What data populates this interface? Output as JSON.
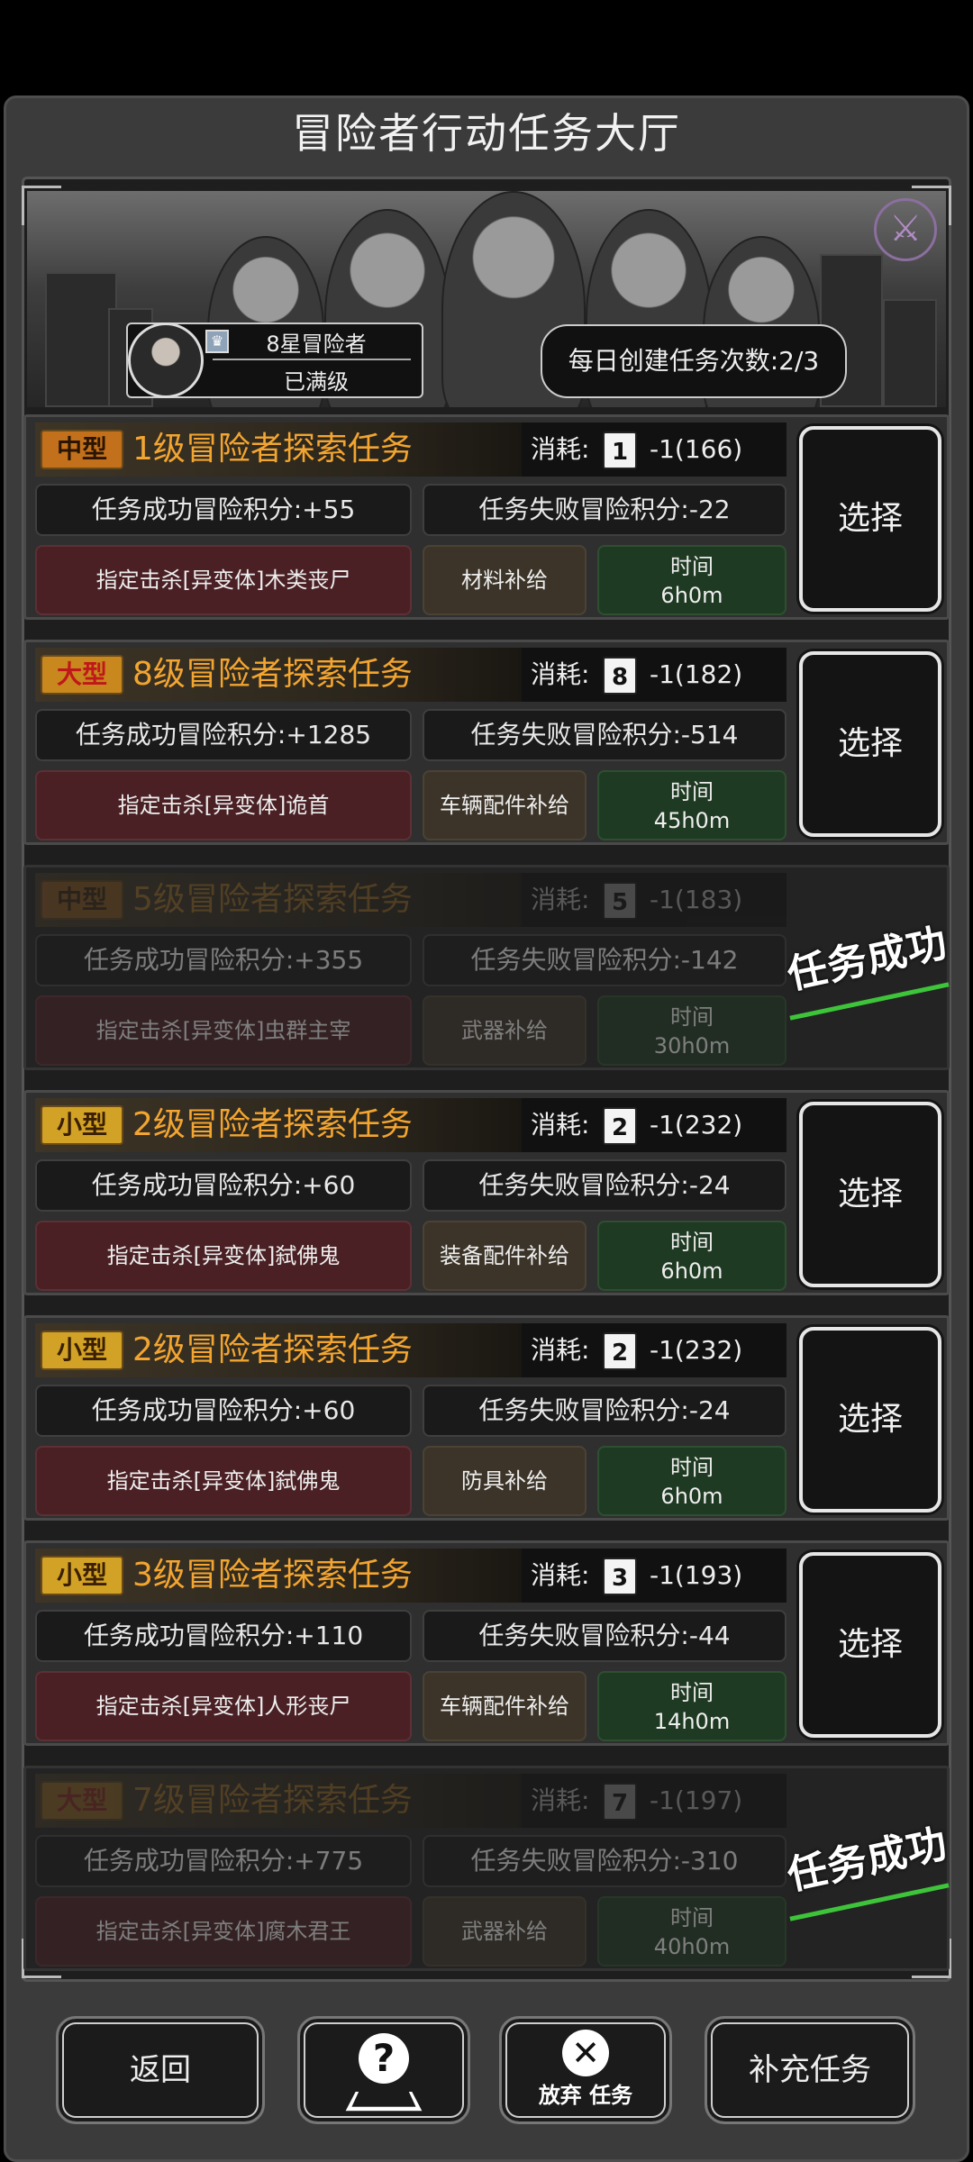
{
  "title": "冒险者行动任务大厅",
  "profile": {
    "rank": "8星冒险者",
    "status": "已满级"
  },
  "daily": "每日创建任务次数:2/3",
  "cost_label": "消耗:",
  "select_label": "选择",
  "success_stamp": "任务成功",
  "time_label": "时间",
  "tasks": [
    {
      "tag": "中型",
      "tag_type": "mid",
      "name": "1级冒险者探索任务",
      "lv": "1",
      "cost": "-1(166)",
      "success": "任务成功冒险积分:+55",
      "fail": "任务失败冒险积分:-22",
      "target": "指定击杀[异变体]木类丧尸",
      "supply": "材料补给",
      "time": "6h0m",
      "completed": false
    },
    {
      "tag": "大型",
      "tag_type": "big",
      "name": "8级冒险者探索任务",
      "lv": "8",
      "cost": "-1(182)",
      "success": "任务成功冒险积分:+1285",
      "fail": "任务失败冒险积分:-514",
      "target": "指定击杀[异变体]诡首",
      "supply": "车辆配件补给",
      "time": "45h0m",
      "completed": false
    },
    {
      "tag": "中型",
      "tag_type": "mid",
      "name": "5级冒险者探索任务",
      "lv": "5",
      "cost": "-1(183)",
      "success": "任务成功冒险积分:+355",
      "fail": "任务失败冒险积分:-142",
      "target": "指定击杀[异变体]虫群主宰",
      "supply": "武器补给",
      "time": "30h0m",
      "completed": true
    },
    {
      "tag": "小型",
      "tag_type": "small",
      "name": "2级冒险者探索任务",
      "lv": "2",
      "cost": "-1(232)",
      "success": "任务成功冒险积分:+60",
      "fail": "任务失败冒险积分:-24",
      "target": "指定击杀[异变体]弑佛鬼",
      "supply": "装备配件补给",
      "time": "6h0m",
      "completed": false
    },
    {
      "tag": "小型",
      "tag_type": "small",
      "name": "2级冒险者探索任务",
      "lv": "2",
      "cost": "-1(232)",
      "success": "任务成功冒险积分:+60",
      "fail": "任务失败冒险积分:-24",
      "target": "指定击杀[异变体]弑佛鬼",
      "supply": "防具补给",
      "time": "6h0m",
      "completed": false
    },
    {
      "tag": "小型",
      "tag_type": "small",
      "name": "3级冒险者探索任务",
      "lv": "3",
      "cost": "-1(193)",
      "success": "任务成功冒险积分:+110",
      "fail": "任务失败冒险积分:-44",
      "target": "指定击杀[异变体]人形丧尸",
      "supply": "车辆配件补给",
      "time": "14h0m",
      "completed": false
    },
    {
      "tag": "大型",
      "tag_type": "big",
      "name": "7级冒险者探索任务",
      "lv": "7",
      "cost": "-1(197)",
      "success": "任务成功冒险积分:+775",
      "fail": "任务失败冒险积分:-310",
      "target": "指定击杀[异变体]腐木君王",
      "supply": "武器补给",
      "time": "40h0m",
      "completed": true
    }
  ],
  "bottom": {
    "back": "返回",
    "abandon": "放弃 任务",
    "refill": "补充任务"
  }
}
